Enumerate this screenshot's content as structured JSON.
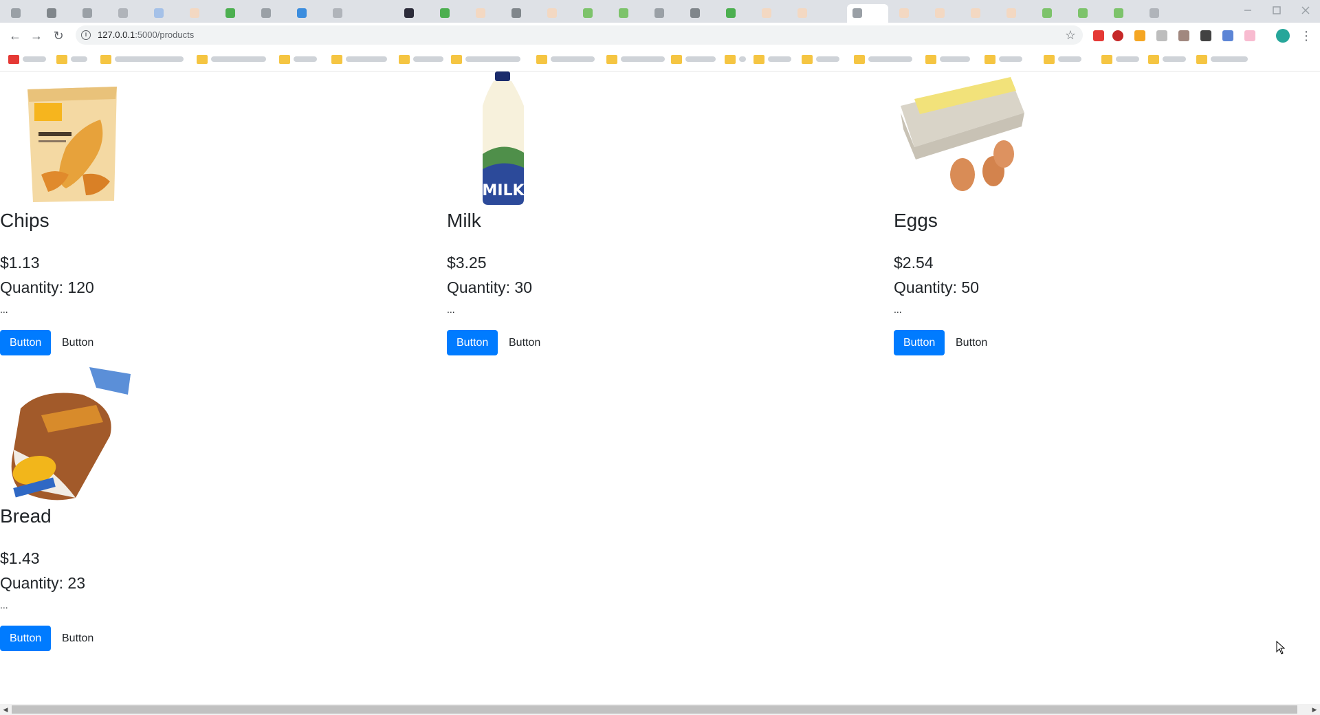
{
  "browser": {
    "url_host": "127.0.0.1",
    "url_path": ":5000/products",
    "colors": {
      "tabstrip": "#dee1e6",
      "omnibox": "#f1f3f4"
    }
  },
  "products": [
    {
      "name": "Chips",
      "price": "$1.13",
      "quantity": "Quantity: 120",
      "description": "...",
      "primary_button": "Button",
      "secondary_button": "Button",
      "image_icon": "chips-bag-icon"
    },
    {
      "name": "Milk",
      "price": "$3.25",
      "quantity": "Quantity: 30",
      "description": "...",
      "primary_button": "Button",
      "secondary_button": "Button",
      "image_icon": "milk-bottle-icon"
    },
    {
      "name": "Eggs",
      "price": "$2.54",
      "quantity": "Quantity: 50",
      "description": "...",
      "primary_button": "Button",
      "secondary_button": "Button",
      "image_icon": "egg-carton-icon"
    },
    {
      "name": "Bread",
      "price": "$1.43",
      "quantity": "Quantity: 23",
      "description": "...",
      "primary_button": "Button",
      "secondary_button": "Button",
      "image_icon": "bread-loaf-icon"
    }
  ],
  "colors": {
    "primary": "#007bff",
    "text": "#212529"
  }
}
